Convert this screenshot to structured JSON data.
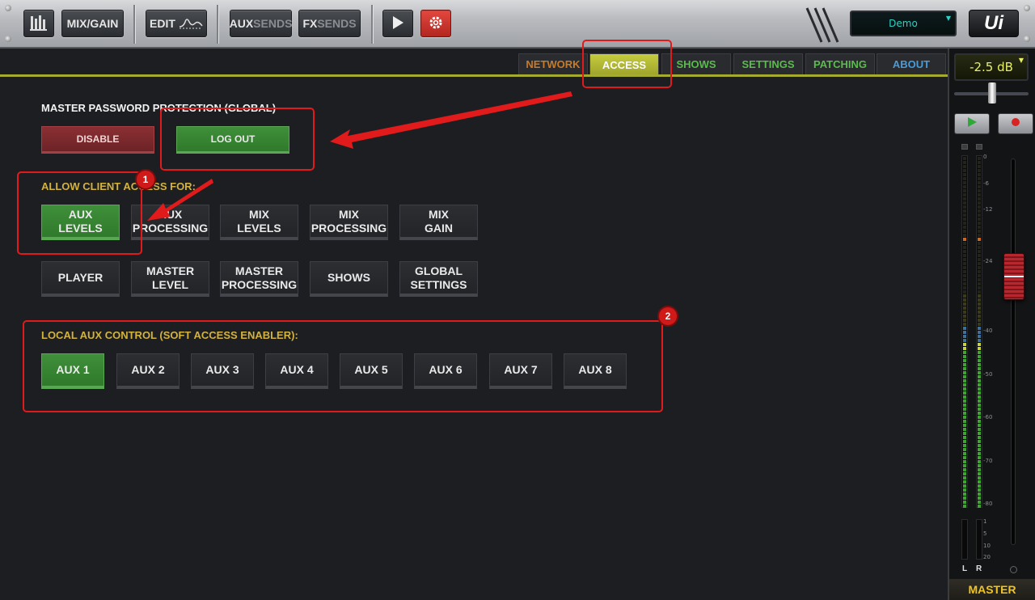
{
  "toolbar": {
    "mix_gain_label": "MIX/GAIN",
    "edit_label": "EDIT",
    "aux_sends": {
      "part1": "AUX",
      "part2": "SENDS"
    },
    "fx_sends": {
      "part1": "FX",
      "part2": "SENDS"
    },
    "show_name": "Demo",
    "logo_text": "Ui"
  },
  "tabs": [
    {
      "label": "NETWORK"
    },
    {
      "label": "ACCESS"
    },
    {
      "label": "SHOWS"
    },
    {
      "label": "SETTINGS"
    },
    {
      "label": "PATCHING"
    },
    {
      "label": "ABOUT"
    }
  ],
  "active_tab": "ACCESS",
  "password": {
    "heading": "MASTER PASSWORD PROTECTION (GLOBAL)",
    "disable_label": "DISABLE",
    "logout_label": "LOG OUT"
  },
  "client_access": {
    "heading": "ALLOW CLIENT ACCESS FOR:",
    "row1": [
      {
        "label": "AUX\nLEVELS",
        "on": true
      },
      {
        "label": "AUX\nPROCESSING",
        "on": false
      },
      {
        "label": "MIX\nLEVELS",
        "on": false
      },
      {
        "label": "MIX\nPROCESSING",
        "on": false
      },
      {
        "label": "MIX\nGAIN",
        "on": false
      }
    ],
    "row2": [
      {
        "label": "PLAYER",
        "on": false
      },
      {
        "label": "MASTER\nLEVEL",
        "on": false
      },
      {
        "label": "MASTER\nPROCESSING",
        "on": false
      },
      {
        "label": "SHOWS",
        "on": false
      },
      {
        "label": "GLOBAL\nSETTINGS",
        "on": false
      }
    ]
  },
  "local_aux": {
    "heading": "LOCAL AUX CONTROL (SOFT ACCESS ENABLER):",
    "buttons": [
      {
        "label": "AUX 1",
        "on": true
      },
      {
        "label": "AUX 2",
        "on": false
      },
      {
        "label": "AUX 3",
        "on": false
      },
      {
        "label": "AUX 4",
        "on": false
      },
      {
        "label": "AUX 5",
        "on": false
      },
      {
        "label": "AUX 6",
        "on": false
      },
      {
        "label": "AUX 7",
        "on": false
      },
      {
        "label": "AUX 8",
        "on": false
      }
    ]
  },
  "annotations": {
    "badge1": "1",
    "badge2": "2"
  },
  "master": {
    "level_display": "-2.5 dB",
    "label": "MASTER",
    "meter_scale": [
      "0",
      "-6",
      "-12",
      "-24",
      "-40",
      "-50",
      "-60",
      "-70",
      "-80"
    ],
    "gr_scale": [
      "1",
      "5",
      "10",
      "20"
    ],
    "left_label": "L",
    "right_label": "R"
  }
}
